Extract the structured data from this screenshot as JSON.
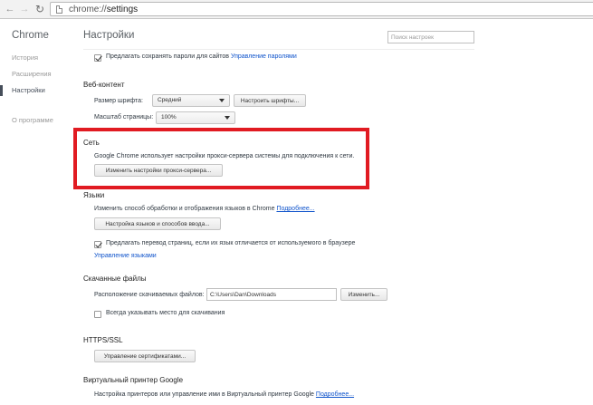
{
  "browser": {
    "url_scheme": "chrome://",
    "url_path": "settings"
  },
  "sidebar": {
    "brand": "Chrome",
    "items": [
      {
        "label": "История"
      },
      {
        "label": "Расширения"
      },
      {
        "label": "Настройки",
        "active": true
      },
      {
        "label": "О программе"
      }
    ]
  },
  "header": {
    "title": "Настройки",
    "search_placeholder": "Поиск настроек"
  },
  "passwords": {
    "offer_save_label": "Предлагать сохранять пароли для сайтов",
    "manage_link": "Управление паролями",
    "checked": true
  },
  "web_content": {
    "title": "Веб-контент",
    "font_size_label": "Размер шрифта:",
    "font_size_value": "Средний",
    "customize_fonts_button": "Настроить шрифты...",
    "zoom_label": "Масштаб страницы:",
    "zoom_value": "100%"
  },
  "network": {
    "title": "Сеть",
    "description": "Google Chrome использует настройки прокси-сервера системы для подключения к сети.",
    "change_proxy_button": "Изменить настройки прокси-сервера..."
  },
  "languages": {
    "title": "Языки",
    "description": "Изменить способ обработки и отображения языков в Chrome",
    "more_link": "Подробнее...",
    "settings_button": "Настройка языков и способов ввода...",
    "translate_label": "Предлагать перевод страниц, если их язык отличается от используемого в браузере",
    "translate_checked": true,
    "manage_link": "Управление языками"
  },
  "downloads": {
    "title": "Скачанные файлы",
    "location_label": "Расположение скачиваемых файлов:",
    "location_value": "C:\\Users\\Dan\\Downloads",
    "change_button": "Изменить...",
    "ask_label": "Всегда указывать место для скачивания",
    "ask_checked": false
  },
  "https": {
    "title": "HTTPS/SSL",
    "certs_button": "Управление сертификатами..."
  },
  "cloud_print": {
    "title": "Виртуальный принтер Google",
    "description": "Настройка принтеров или управление ими в Виртуальный принтер Google",
    "more_link": "Подробнее..."
  },
  "colors": {
    "highlight": "#e11b22",
    "link": "#1155cc"
  }
}
